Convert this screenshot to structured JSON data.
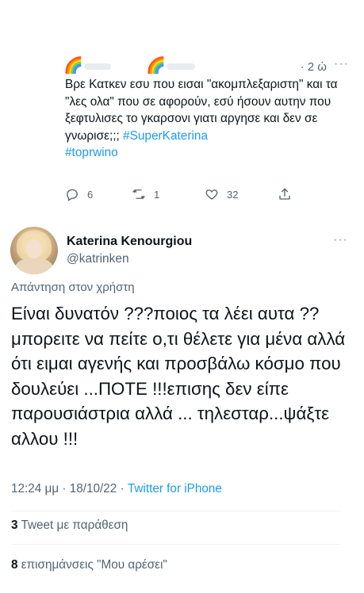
{
  "parent_tweet": {
    "emoji_1": "🌈",
    "emoji_2": "🌈",
    "time": "· 2 ώ",
    "more": "···",
    "text": "Βρε Κατκεν εσυ που εισαι \"ακομπλεξαριστη\" και τα \"λες ολα\" που σε αφορούν, εσύ ήσουν αυτην που ξεφτυλισες το γκαρσονι γιατι αργησε και δεν σε γνωρισε;;; ",
    "hashtag_1": "#SuperKaterina",
    "hashtag_2": "#toprwino",
    "replies": "6",
    "retweets": "1",
    "likes": "32",
    "icons": {
      "reply": "reply-icon",
      "retweet": "retweet-icon",
      "like": "heart-icon",
      "share": "share-icon"
    }
  },
  "main_tweet": {
    "display_name": "Katerina Kenourgiou",
    "handle": "@katrinken",
    "more": "···",
    "reply_to": "Απάντηση στον χρήστη",
    "text": "Είναι δυνατόν ???ποιος τα λέει αυτα ?? μπορειτε να πείτε ο,τι θέλετε για μένα αλλά ότι ειμαι αγενής και προσβάλω κόσμο που δουλεύει ...ΠΟΤΕ !!!επισης δεν είπε παρουσιάστρια αλλά ... τηλεσταρ...ψάξτε αλλου !!!",
    "time": "12:24 μμ · 18/10/22 · ",
    "source": "Twitter for iPhone",
    "quote_count": "3",
    "quote_label": " Tweet με παράθεση",
    "like_count": "8",
    "like_label": " επισημάνσεις \"Μου αρέσει\""
  },
  "colors": {
    "text": "#0f1419",
    "secondary": "#536471",
    "link": "#1d9bf0",
    "divider": "#eff3f4"
  }
}
